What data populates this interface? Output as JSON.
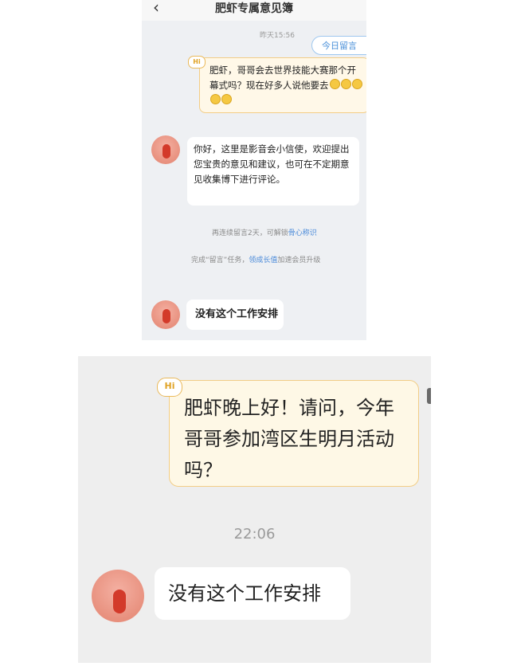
{
  "panel1": {
    "header": {
      "back_icon": "chevron-left-icon",
      "title": "肥虾专属意见簿"
    },
    "timestamp": "昨天15:56",
    "chip_label": "今日留言",
    "hi_badge": "Hi",
    "my_message": "肥虾，哥哥会去世界技能大赛那个开幕式吗？现在好多人说他要去",
    "bot_message": "你好，这里是影音会小信使，欢迎提出您宝贵的意见和建议，也可在不定期意见收集博下进行评论。",
    "note1": {
      "text": "再连续留言2天，可解锁",
      "link": "骨心称识"
    },
    "note2": {
      "prefix": "完成“留言”任务，",
      "link": "领成长值",
      "suffix": "加速会员升级"
    },
    "reply": "没有这个工作安排"
  },
  "panel2": {
    "hi_badge": "Hi",
    "my_message": "肥虾晚上好！请问，今年哥哥参加湾区生明月活动吗？",
    "timestamp": "22:06",
    "reply": "没有这个工作安排"
  },
  "colors": {
    "chip_blue": "#4a90d9",
    "bubble_yellow": "#fef8e6",
    "bubble_border": "#f2cd86",
    "shrimp_red": "#d33a2a"
  }
}
